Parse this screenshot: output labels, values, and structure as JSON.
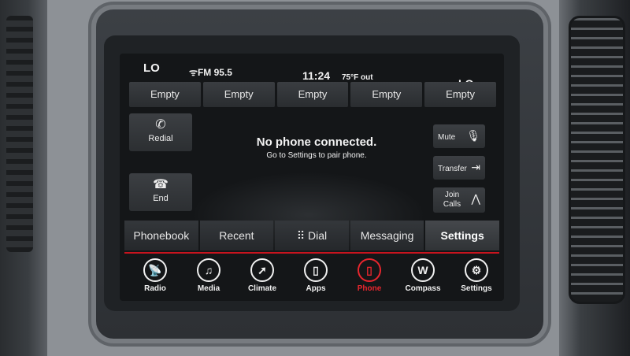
{
  "status": {
    "left_zone": "LO",
    "radio": "FM 95.5",
    "time": "11:24",
    "temperature": "75°F out",
    "right_zone": "LO"
  },
  "presets": [
    "Empty",
    "Empty",
    "Empty",
    "Empty",
    "Empty"
  ],
  "call_buttons": {
    "redial": "Redial",
    "end": "End"
  },
  "side_buttons": {
    "mute": "Mute",
    "transfer": "Transfer",
    "join_calls": "Join Calls"
  },
  "message": {
    "title": "No phone connected.",
    "subtitle": "Go to Settings to pair phone."
  },
  "tabs": [
    "Phonebook",
    "Recent",
    "Dial",
    "Messaging",
    "Settings"
  ],
  "nav": [
    {
      "label": "Radio",
      "icon": "radio-icon"
    },
    {
      "label": "Media",
      "icon": "music-note-icon"
    },
    {
      "label": "Climate",
      "icon": "climate-icon"
    },
    {
      "label": "Apps",
      "icon": "apps-icon"
    },
    {
      "label": "Phone",
      "icon": "phone-icon",
      "active": true
    },
    {
      "label": "Compass",
      "icon": "compass-icon"
    },
    {
      "label": "Settings",
      "icon": "gear-icon"
    }
  ],
  "colors": {
    "accent": "#e8262e",
    "screen_bg": "#141618"
  }
}
